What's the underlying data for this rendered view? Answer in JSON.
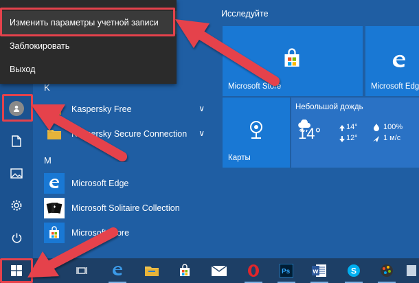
{
  "context_menu": {
    "items": [
      {
        "label": "Изменить параметры учетной записи"
      },
      {
        "label": "Заблокировать"
      },
      {
        "label": "Выход"
      }
    ]
  },
  "app_list": {
    "partial_letter": "K",
    "group_m_letter": "M",
    "items": [
      {
        "label": "Kaspersky Free",
        "icon": "folder-icon"
      },
      {
        "label": "Kaspersky Secure Connection",
        "icon": "folder-icon"
      },
      {
        "label": "Microsoft Edge",
        "icon": "edge-icon"
      },
      {
        "label": "Microsoft Solitaire Collection",
        "icon": "cards-icon"
      },
      {
        "label": "Microsoft Store",
        "icon": "store-icon"
      }
    ]
  },
  "tiles": {
    "header": "Исследуйте",
    "store_label": "Microsoft Store",
    "edge_label": "Microsoft Edg",
    "maps_label": "Карты",
    "weather": {
      "condition": "Небольшой дождь",
      "temp": "14°",
      "high": "14°",
      "low": "12°",
      "humidity": "100%",
      "wind": "1 м/с"
    }
  },
  "colors": {
    "highlight": "#e5424c",
    "tile": "#1978d4",
    "accent": "#1f5ea3"
  }
}
